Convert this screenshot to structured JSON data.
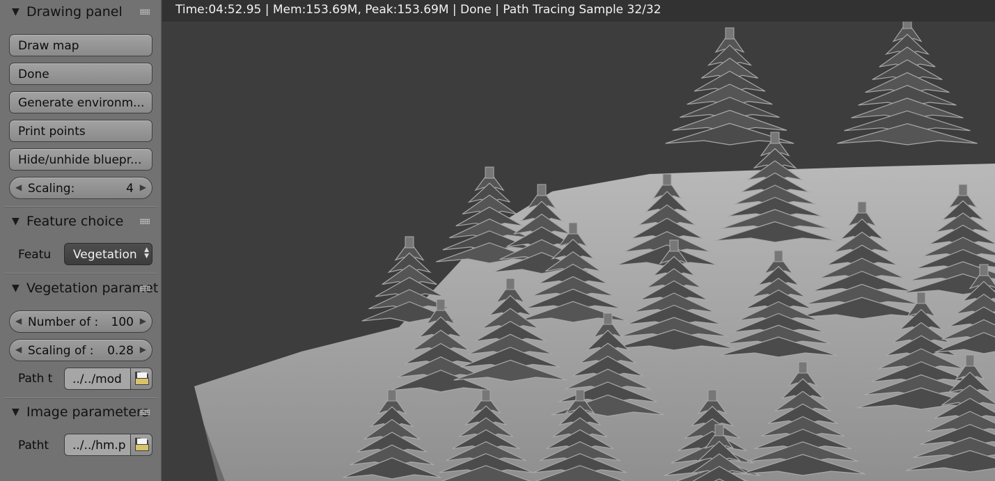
{
  "drawing_panel": {
    "title": "Drawing panel",
    "buttons": [
      "Draw map",
      "Done",
      "Generate environm...",
      "Print points",
      "Hide/unhide bluepr..."
    ],
    "scaling": {
      "label": "Scaling:",
      "value": "4"
    }
  },
  "feature_choice": {
    "title": "Feature choice",
    "label": "Featu",
    "selected": "Vegetation"
  },
  "vegetation_parameters": {
    "title": "Vegetation paramet",
    "number": {
      "label": "Number of :",
      "value": "100"
    },
    "scaling": {
      "label": "Scaling of :",
      "value": "0.28"
    },
    "path": {
      "label": "Path t",
      "value": "../../mod"
    }
  },
  "image_parameters": {
    "title": "Image parameters",
    "path": {
      "label": "Patht",
      "value": "../../hm.p"
    }
  },
  "render": {
    "status": "Time:04:52.95 | Mem:153.69M, Peak:153.69M | Done | Path Tracing Sample 32/32"
  }
}
